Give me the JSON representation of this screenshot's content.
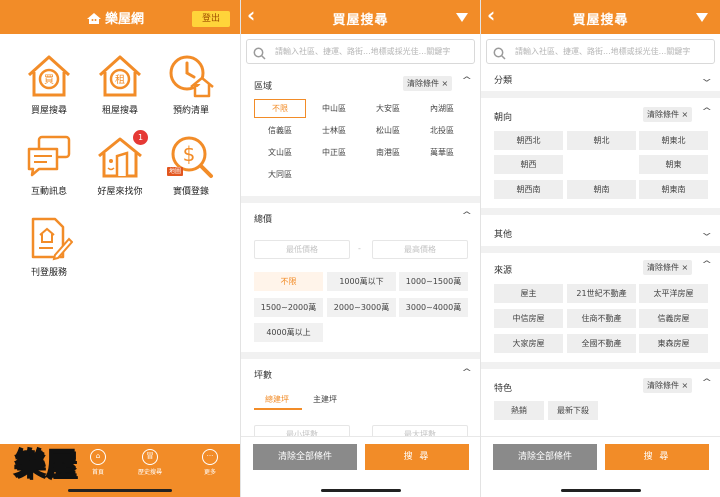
{
  "home": {
    "brand": "樂屋網",
    "logout": "登出",
    "tiles": [
      {
        "label": "買屋搜尋",
        "glyph": "買"
      },
      {
        "label": "租屋搜尋",
        "glyph": "租"
      },
      {
        "label": "預約清單",
        "glyph": ""
      },
      {
        "label": "互動訊息",
        "glyph": ""
      },
      {
        "label": "好屋來找你",
        "glyph": "",
        "badge": "1"
      },
      {
        "label": "實價登錄",
        "glyph": "$",
        "tag": "地圖"
      },
      {
        "label": "刊登服務",
        "glyph": ""
      }
    ],
    "footer": [
      {
        "label": "首頁",
        "glyph": "⌂"
      },
      {
        "label": "歷史搜尋",
        "glyph": "冒"
      },
      {
        "label": "更多",
        "glyph": "···"
      }
    ],
    "watermark": "樂屋"
  },
  "buy": {
    "title": "買屋搜尋",
    "search_placeholder": "請輸入社區、捷運、路街...地標或採光佳...關鍵字",
    "region": {
      "title": "區域",
      "clear": "清除條件 ×",
      "options": [
        "不限",
        "中山區",
        "大安區",
        "內湖區",
        "信義區",
        "士林區",
        "松山區",
        "北投區",
        "文山區",
        "中正區",
        "南港區",
        "萬華區",
        "大同區"
      ],
      "selected": "不限"
    },
    "price": {
      "title": "總價",
      "min_placeholder": "最低價格",
      "max_placeholder": "最高價格",
      "separator": "-",
      "options": [
        "不限",
        "1000萬以下",
        "1000~1500萬",
        "1500~2000萬",
        "2000~3000萬",
        "3000~4000萬",
        "4000萬以上"
      ],
      "selected": "不限"
    },
    "area": {
      "title": "坪數",
      "tabs": [
        "總建坪",
        "主建坪"
      ],
      "selected_tab": "總建坪",
      "min_placeholder": "最小坪數",
      "max_placeholder": "最大坪數"
    },
    "clear_all": "清除全部條件",
    "search": "搜 尋"
  },
  "buy2": {
    "title": "買屋搜尋",
    "search_placeholder": "請輸入社區、捷運、路街...地標或採光佳...關鍵字",
    "category": {
      "title": "分類"
    },
    "orientation": {
      "title": "朝向",
      "clear": "清除條件 ×",
      "options": [
        "朝西北",
        "朝北",
        "朝東北",
        "朝西",
        "",
        "朝東",
        "朝西南",
        "朝南",
        "朝東南"
      ]
    },
    "other": {
      "title": "其他"
    },
    "source": {
      "title": "來源",
      "clear": "清除條件 ×",
      "options": [
        "屋主",
        "21世紀不動產",
        "太平洋房屋",
        "中信房屋",
        "住商不動產",
        "信義房屋",
        "大家房屋",
        "全國不動產",
        "東森房屋"
      ]
    },
    "feature": {
      "title": "特色",
      "clear": "清除條件 ×",
      "options": [
        "熱銷",
        "最新下殺"
      ]
    },
    "clear_all": "清除全部條件",
    "search": "搜 尋"
  },
  "colors": {
    "accent": "#f28c28",
    "badge": "#e53935",
    "logout_bg": "#ffd43a"
  }
}
